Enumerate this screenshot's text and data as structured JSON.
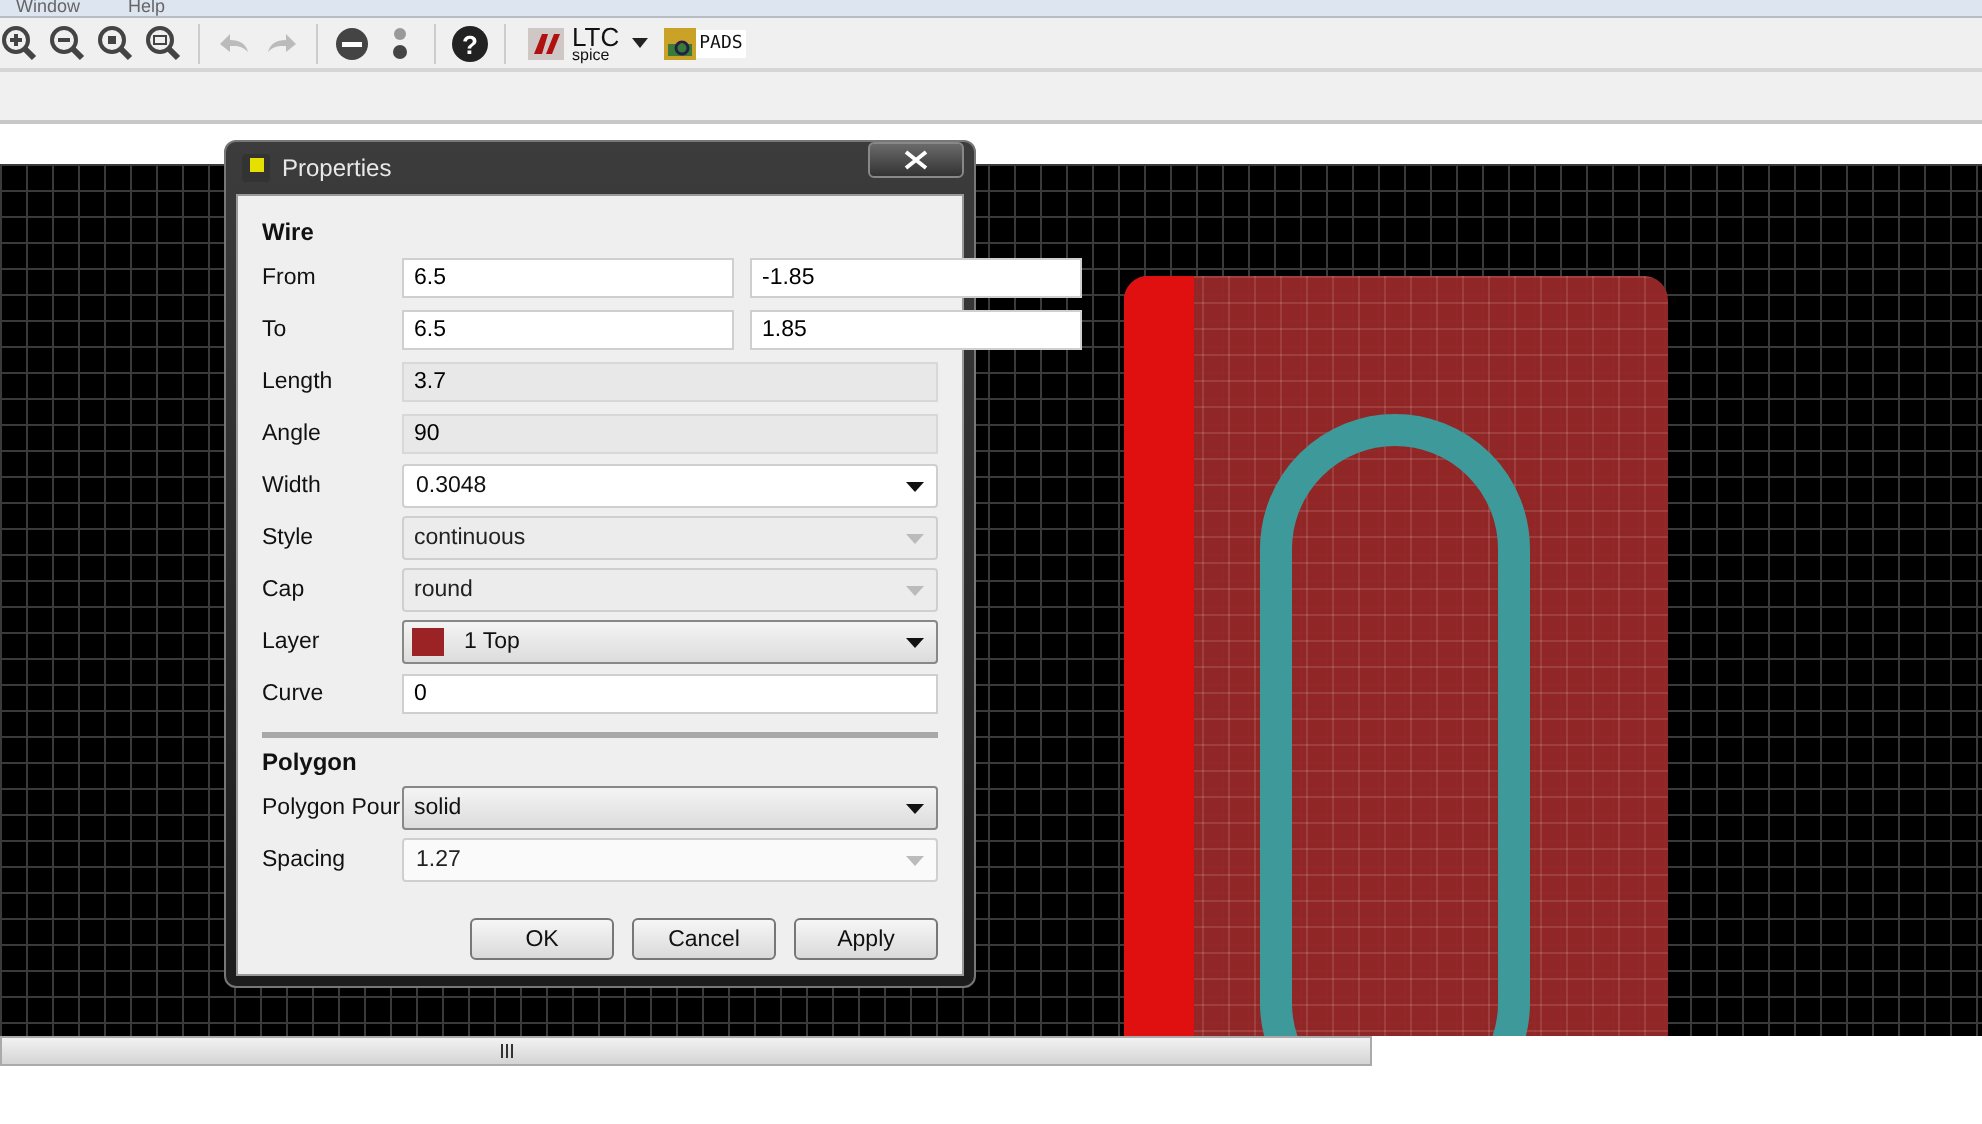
{
  "menu": [
    "Window",
    "Help"
  ],
  "toolbar": [
    {
      "kind": "zoom-in",
      "disabled": false
    },
    {
      "kind": "zoom-out",
      "disabled": false
    },
    {
      "kind": "zoom-fit",
      "disabled": false
    },
    {
      "kind": "zoom-select",
      "disabled": false
    },
    {
      "kind": "sep"
    },
    {
      "kind": "undo",
      "disabled": true
    },
    {
      "kind": "redo",
      "disabled": true
    },
    {
      "kind": "sep"
    },
    {
      "kind": "stop",
      "disabled": false
    },
    {
      "kind": "dots"
    },
    {
      "kind": "sep"
    },
    {
      "kind": "help",
      "glyph": "?"
    },
    {
      "kind": "sep"
    }
  ],
  "ltspice": {
    "top": "LTC",
    "bottom": "spice"
  },
  "pads": {
    "label": "PADS"
  },
  "dialog": {
    "title": "Properties",
    "sections": [
      {
        "title": "Wire",
        "rows": [
          {
            "label": "From",
            "kind": "pair",
            "values": [
              "6.5",
              "-1.85"
            ]
          },
          {
            "label": "To",
            "kind": "pair",
            "values": [
              "6.5",
              "1.85"
            ]
          },
          {
            "label": "Length",
            "kind": "readonly",
            "value": "3.7"
          },
          {
            "label": "Angle",
            "kind": "readonly",
            "value": "90"
          },
          {
            "label": "Width",
            "kind": "combo",
            "value": "0.3048",
            "editable": true,
            "disabled": false
          },
          {
            "label": "Style",
            "kind": "combo",
            "value": "continuous",
            "editable": false,
            "disabled": true
          },
          {
            "label": "Cap",
            "kind": "combo",
            "value": "round",
            "editable": false,
            "disabled": true
          },
          {
            "label": "Layer",
            "kind": "layer",
            "value": "1 Top",
            "color": "#9b2326"
          },
          {
            "label": "Curve",
            "kind": "text",
            "value": "0"
          }
        ]
      },
      {
        "title": "Polygon",
        "rows": [
          {
            "label": "Polygon Pour",
            "kind": "combo",
            "value": "solid",
            "editable": false,
            "disabled": false
          },
          {
            "label": "Spacing",
            "kind": "combo",
            "value": "1.27",
            "editable": true,
            "disabled": true
          }
        ]
      }
    ],
    "buttons": [
      "OK",
      "Cancel",
      "Apply"
    ]
  }
}
